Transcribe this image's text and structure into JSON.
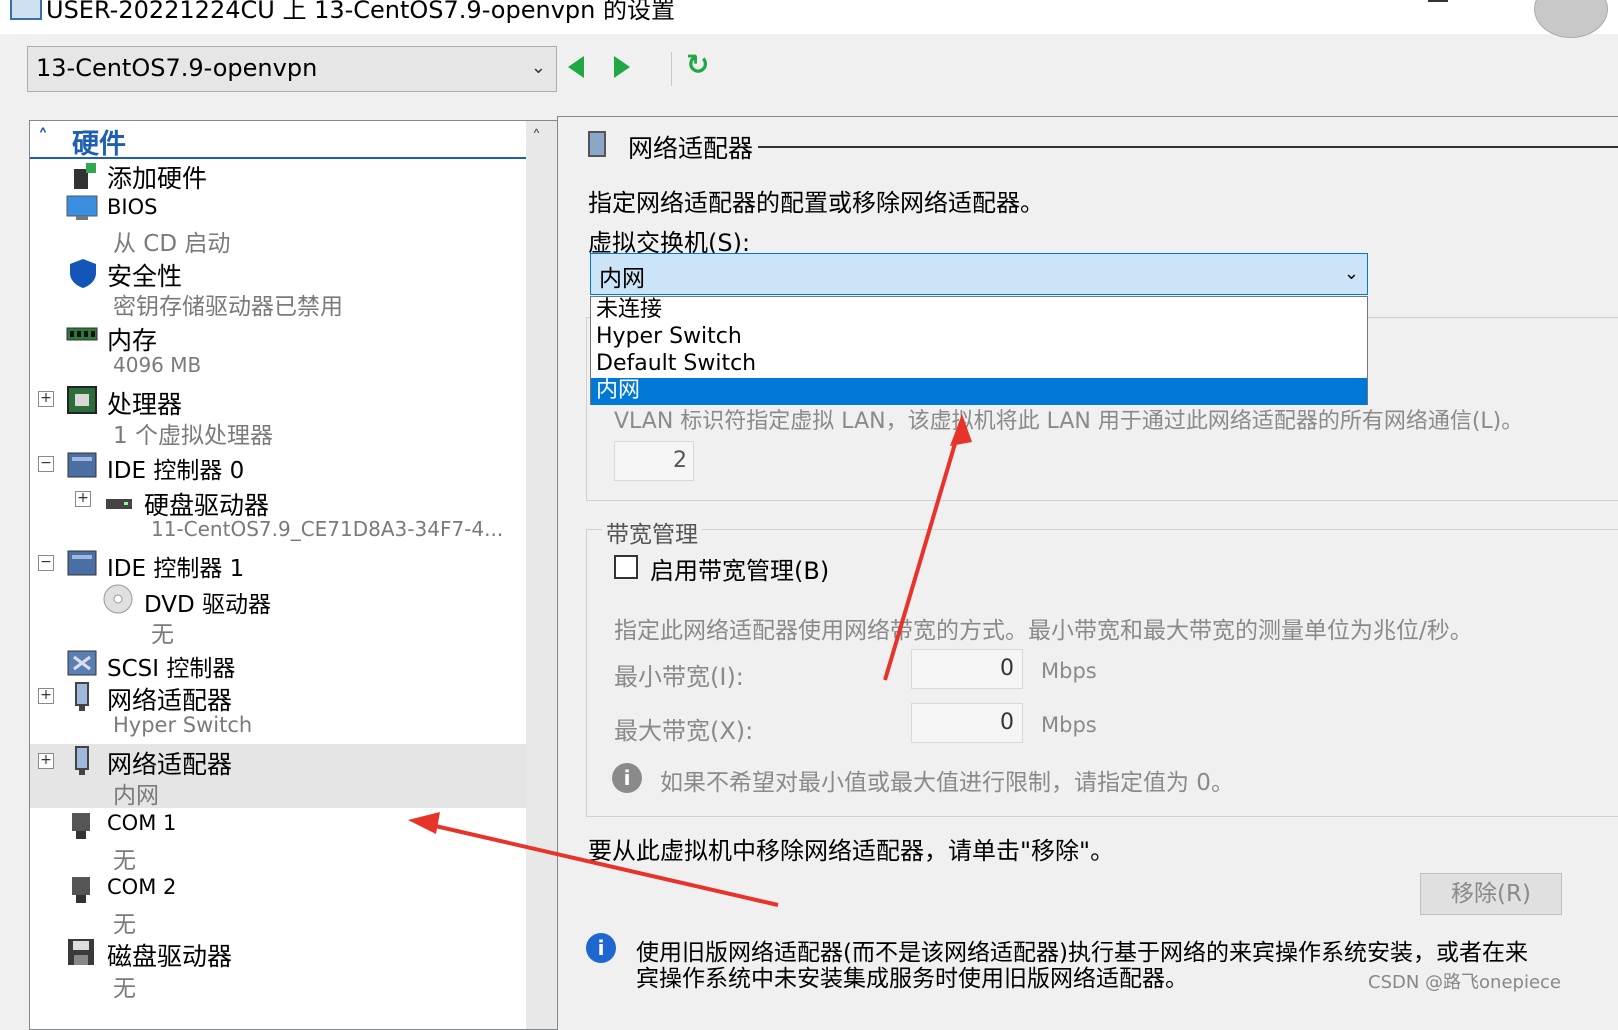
{
  "window": {
    "title": "USER-20221224CU 上 13-CentOS7.9-openvpn 的设置"
  },
  "toolbar": {
    "vm_name": "13-CentOS7.9-openvpn"
  },
  "hardware": {
    "title": "硬件",
    "items": [
      {
        "label": "添加硬件"
      },
      {
        "label": "BIOS",
        "sub": "从 CD 启动"
      },
      {
        "label": "安全性",
        "sub": "密钥存储驱动器已禁用"
      },
      {
        "label": "内存",
        "sub": "4096 MB"
      },
      {
        "label": "处理器",
        "sub": "1 个虚拟处理器"
      },
      {
        "label": "IDE 控制器 0"
      },
      {
        "label": "硬盘驱动器",
        "sub": "11-CentOS7.9_CE71D8A3-34F7-4..."
      },
      {
        "label": "IDE 控制器 1"
      },
      {
        "label": "DVD 驱动器",
        "sub": "无"
      },
      {
        "label": "SCSI 控制器"
      },
      {
        "label": "网络适配器",
        "sub": "Hyper Switch"
      },
      {
        "label": "网络适配器",
        "sub": "内网"
      },
      {
        "label": "COM 1",
        "sub": "无"
      },
      {
        "label": "COM 2",
        "sub": "无"
      },
      {
        "label": "磁盘驱动器",
        "sub": "无"
      }
    ]
  },
  "adapter": {
    "title": "网络适配器",
    "description": "指定网络适配器的配置或移除网络适配器。",
    "switch_label": "虚拟交换机(S):",
    "switch_value": "内网",
    "switch_options": [
      "未连接",
      "Hyper Switch",
      "Default Switch",
      "内网"
    ],
    "vlan_text": "VLAN 标识符指定虚拟 LAN，该虚拟机将此 LAN 用于通过此网络适配器的所有网络通信(L)。",
    "vlan_value": "2",
    "bandwidth": {
      "legend": "带宽管理",
      "enable_label": "启用带宽管理(B)",
      "enabled": false,
      "description": "指定此网络适配器使用网络带宽的方式。最小带宽和最大带宽的测量单位为兆位/秒。",
      "min_label": "最小带宽(I):",
      "min_value": "0",
      "max_label": "最大带宽(X):",
      "max_value": "0",
      "unit": "Mbps",
      "hint": "如果不希望对最小值或最大值进行限制，请指定值为 0。"
    },
    "remove_text": "要从此虚拟机中移除网络适配器，请单击\"移除\"。",
    "remove_button": "移除(R)",
    "legacy_note_line1": "使用旧版网络适配器(而不是该网络适配器)执行基于网络的来宾操作系统安装，或者在来",
    "legacy_note_line2": "宾操作系统中未安装集成服务时使用旧版网络适配器。"
  },
  "watermark": "CSDN @路飞onepiece",
  "colors": {
    "accent": "#1e5fb4",
    "selection": "#0078d7",
    "nav_green": "#1fa843",
    "annotation": "#e8332a"
  }
}
